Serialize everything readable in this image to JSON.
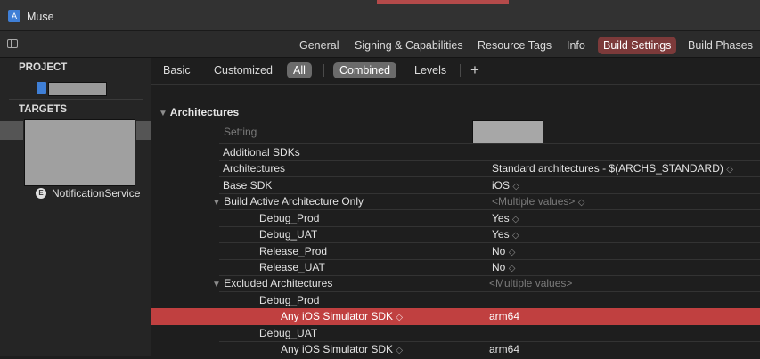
{
  "window": {
    "title": "Muse"
  },
  "tabs": [
    {
      "label": "General"
    },
    {
      "label": "Signing & Capabilities"
    },
    {
      "label": "Resource Tags"
    },
    {
      "label": "Info"
    },
    {
      "label": "Build Settings"
    },
    {
      "label": "Build Phases"
    }
  ],
  "sidebar": {
    "project_header": "PROJECT",
    "targets_header": "TARGETS",
    "extension_target": "NotificationService"
  },
  "filters": {
    "basic": "Basic",
    "customized": "Customized",
    "all": "All",
    "combined": "Combined",
    "levels": "Levels",
    "add": "+"
  },
  "section": {
    "title": "Architectures",
    "setting_header": "Setting"
  },
  "rows": [
    {
      "name": "Additional SDKs",
      "value": ""
    },
    {
      "name": "Architectures",
      "value": "Standard architectures  -  $(ARCHS_STANDARD)",
      "chevron": "◇"
    },
    {
      "name": "Base SDK",
      "value": "iOS",
      "chevron": "◇"
    },
    {
      "name": "Build Active Architecture Only",
      "value": "<Multiple values>",
      "chevron": "◇"
    },
    {
      "name": "Debug_Prod",
      "value": "Yes",
      "chevron": "◇"
    },
    {
      "name": "Debug_UAT",
      "value": "Yes",
      "chevron": "◇"
    },
    {
      "name": "Release_Prod",
      "value": "No",
      "chevron": "◇"
    },
    {
      "name": "Release_UAT",
      "value": "No",
      "chevron": "◇"
    },
    {
      "name": "Excluded Architectures",
      "value": "<Multiple values>"
    },
    {
      "name": "Debug_Prod",
      "value": ""
    },
    {
      "name": "Any iOS Simulator SDK",
      "value": "arm64",
      "chevron": "◇"
    },
    {
      "name": "Debug_UAT",
      "value": ""
    },
    {
      "name": "Any iOS Simulator SDK",
      "value": "arm64",
      "chevron": "◇"
    }
  ],
  "disclosure": "▼",
  "colors": {
    "accent_tab": "#7c3a3a",
    "highlight_row": "#c04040"
  }
}
